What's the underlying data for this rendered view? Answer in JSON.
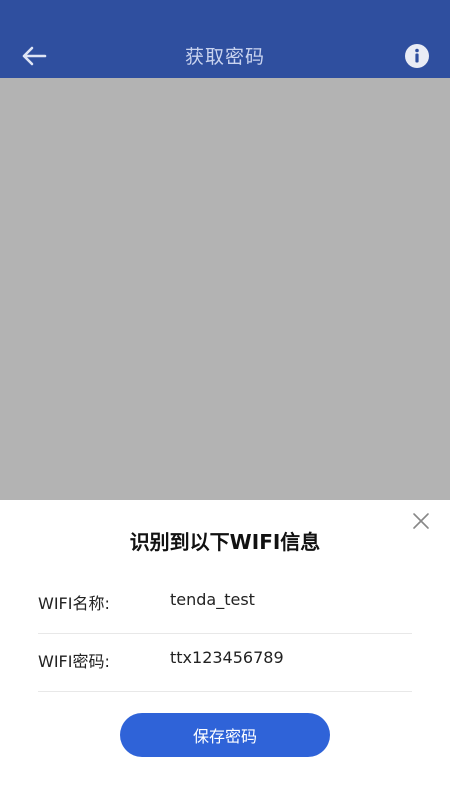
{
  "header": {
    "title": "获取密码",
    "back_icon": "arrow-left-icon",
    "info_icon": "info-icon"
  },
  "sheet": {
    "title": "识别到以下WIFI信息",
    "close_icon": "close-icon",
    "fields": [
      {
        "label": "WIFI名称:",
        "value": "tenda_test"
      },
      {
        "label": "WIFI密码:",
        "value": "ttx123456789"
      }
    ],
    "save_label": "保存密码"
  },
  "colors": {
    "header_bg": "#2f4f9f",
    "camera_bg": "#b3b3b3",
    "button_bg": "#2f63d8"
  }
}
